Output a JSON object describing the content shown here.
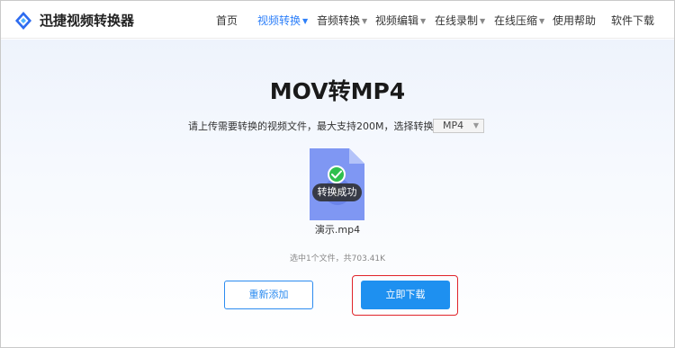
{
  "app": {
    "brand": "迅捷视频转换器"
  },
  "nav": {
    "items": [
      {
        "label": "首页",
        "has_dropdown": false,
        "active": false
      },
      {
        "label": "视频转换",
        "has_dropdown": true,
        "active": true
      },
      {
        "label": "音频转换",
        "has_dropdown": true,
        "active": false
      },
      {
        "label": "视频编辑",
        "has_dropdown": true,
        "active": false
      },
      {
        "label": "在线录制",
        "has_dropdown": true,
        "active": false
      },
      {
        "label": "在线压缩",
        "has_dropdown": true,
        "active": false
      },
      {
        "label": "使用帮助",
        "has_dropdown": false,
        "active": false
      },
      {
        "label": "软件下载",
        "has_dropdown": false,
        "active": false
      }
    ],
    "caret_glyph": "▼"
  },
  "main": {
    "title": "MOV转MP4",
    "upload_prompt": "请上传需要转换的视频文件，最大支持200M，选择转换格式：",
    "format_select": {
      "value": "MP4",
      "caret": "▼"
    },
    "file": {
      "name": "演示.mp4",
      "status": "转换成功",
      "icon": "video-file-icon",
      "status_icon": "check-icon"
    },
    "file_count": "选中1个文件，共703.41K",
    "buttons": {
      "readd": "重新添加",
      "download": "立即下载"
    }
  },
  "colors": {
    "accent": "#2d7ff9",
    "download_button": "#1e90f0",
    "highlight": "#e0242a",
    "success": "#2fbf4e",
    "file_icon": "#7f97f3"
  }
}
